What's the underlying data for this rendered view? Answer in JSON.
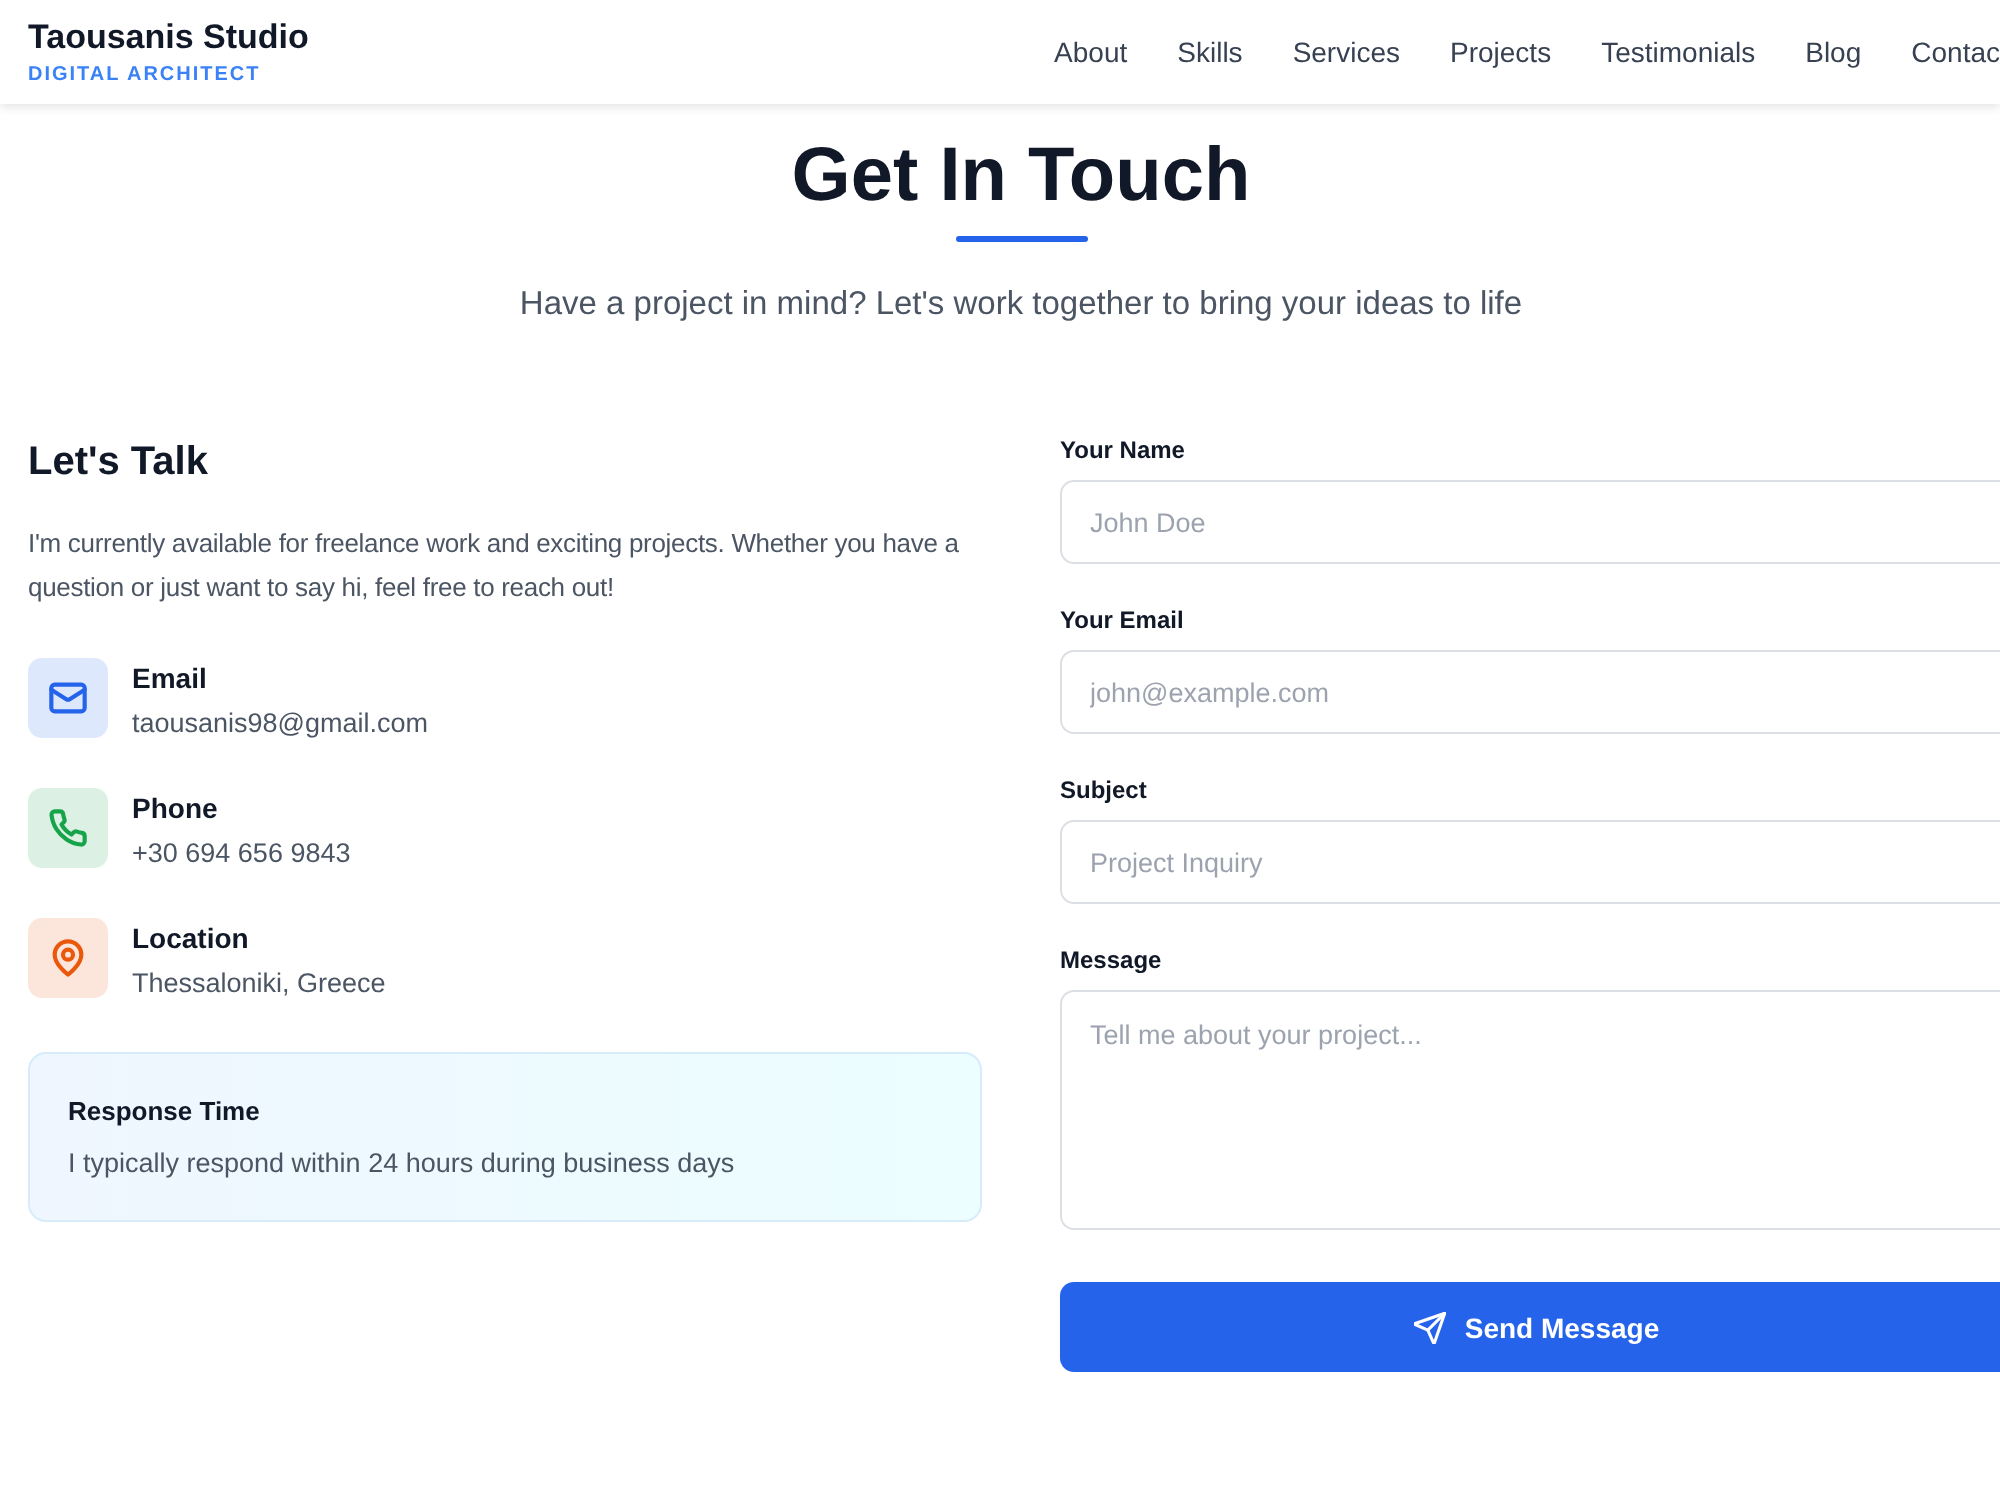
{
  "header": {
    "logo": {
      "title": "Taousanis Studio",
      "tagline": "DIGITAL ARCHITECT"
    },
    "nav": [
      "About",
      "Skills",
      "Services",
      "Projects",
      "Testimonials",
      "Blog",
      "Contac"
    ]
  },
  "intro": {
    "title": "Get In Touch",
    "subtitle": "Have a project in mind? Let's work together to bring your ideas to life"
  },
  "info": {
    "title": "Let's Talk",
    "text": "I'm currently available for freelance work and exciting projects. Whether you have a question or just want to say hi, feel free to reach out!",
    "contacts": [
      {
        "kind": "email",
        "label": "Email",
        "value": "taousanis98@gmail.com",
        "color": "#2563eb"
      },
      {
        "kind": "phone",
        "label": "Phone",
        "value": "+30 694 656 9843",
        "color": "#16a34a"
      },
      {
        "kind": "location",
        "label": "Location",
        "value": "Thessaloniki, Greece",
        "color": "#ea580c"
      }
    ],
    "note": {
      "title": "Response Time",
      "text": "I typically respond within 24 hours during business days"
    }
  },
  "form": {
    "fields": [
      {
        "kind": "input",
        "label": "Your Name",
        "placeholder": "John Doe"
      },
      {
        "kind": "input",
        "label": "Your Email",
        "placeholder": "john@example.com"
      },
      {
        "kind": "input",
        "label": "Subject",
        "placeholder": "Project Inquiry"
      },
      {
        "kind": "textarea",
        "label": "Message",
        "placeholder": "Tell me about your project..."
      }
    ],
    "submit": "Send Message"
  }
}
